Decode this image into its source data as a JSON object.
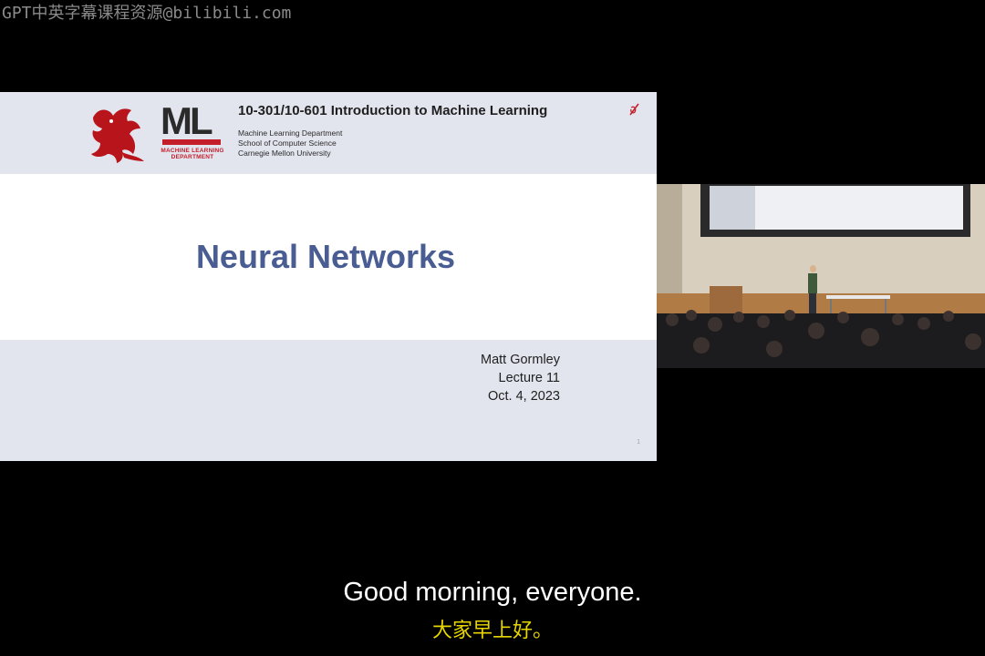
{
  "watermark": "GPT中英字幕课程资源@bilibili.com",
  "slide": {
    "logo": {
      "griffin_icon": "cmu-griffin-icon",
      "letters": "ML",
      "sub_line1": "MACHINE LEARNING",
      "sub_line2": "DEPARTMENT"
    },
    "course_title": "10-301/10-601 Introduction to Machine Learning",
    "dept_line1": "Machine Learning Department",
    "dept_line2": "School of Computer Science",
    "dept_line3": "Carnegie Mellon University",
    "title": "Neural Networks",
    "author": "Matt Gormley",
    "lecture": "Lecture 11",
    "date": "Oct. 4, 2023",
    "slide_number": "1"
  },
  "camera": {
    "description_icon": "lecture-hall-camera"
  },
  "subtitles": {
    "english": "Good morning, everyone.",
    "chinese": "大家早上好。"
  },
  "colors": {
    "title_blue": "#4a5d92",
    "brand_red": "#c41e2a",
    "header_band": "#e3e5ee",
    "subtitle_zh": "#e8d600"
  }
}
